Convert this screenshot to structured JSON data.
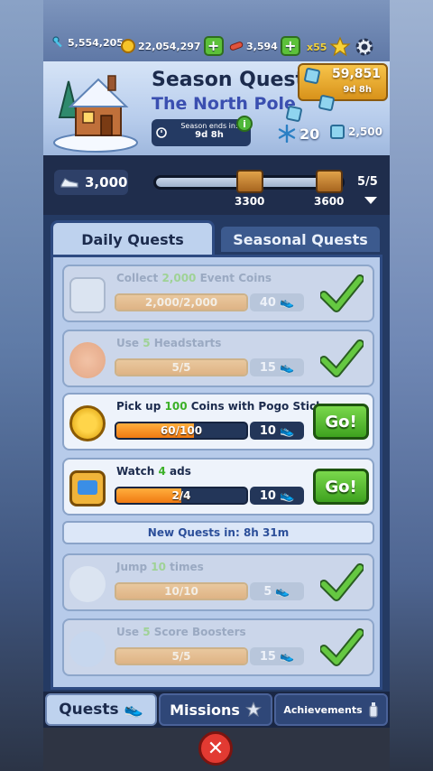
{
  "header": {
    "keys": "5,554,205",
    "coins": "22,054,297",
    "hoverboards": "3,594",
    "multiplier": "x55"
  },
  "season": {
    "title": "Season Quests",
    "subtitle": "The North Pole",
    "ends_label": "Season ends in:",
    "ends_value": "9d 8h",
    "currency_value": "59,851",
    "currency_timer": "9d 8h",
    "ice_count": "20",
    "ice_total": "2,500"
  },
  "progress": {
    "tokens": "3,000",
    "fill_fraction": 1.0,
    "milestones": [
      "3300",
      "3600"
    ],
    "count": "5/5"
  },
  "tabs": {
    "daily": "Daily Quests",
    "seasonal": "Seasonal Quests"
  },
  "quests": [
    {
      "title_pre": "Collect ",
      "title_num": "2,000",
      "title_post": " Event Coins",
      "progress": "2,000/2,000",
      "fraction": 1.0,
      "reward": "40",
      "done": true
    },
    {
      "title_pre": "Use ",
      "title_num": "5",
      "title_post": " Headstarts",
      "progress": "5/5",
      "fraction": 1.0,
      "reward": "15",
      "done": true
    },
    {
      "title_pre": "Pick up ",
      "title_num": "100",
      "title_post": " Coins with Pogo Sticks",
      "progress": "60/100",
      "fraction": 0.6,
      "reward": "10",
      "done": false,
      "action": "Go!"
    },
    {
      "title_pre": "Watch ",
      "title_num": "4",
      "title_post": " ads",
      "progress": "2/4",
      "fraction": 0.5,
      "reward": "10",
      "done": false,
      "action": "Go!"
    },
    {
      "title_pre": "Jump ",
      "title_num": "10",
      "title_post": " times",
      "progress": "10/10",
      "fraction": 1.0,
      "reward": "5",
      "done": true
    },
    {
      "title_pre": "Use ",
      "title_num": "5",
      "title_post": " Score Boosters",
      "progress": "5/5",
      "fraction": 1.0,
      "reward": "15",
      "done": true
    }
  ],
  "new_quests_text": "New Quests in: 8h 31m",
  "bottom_nav": {
    "quests": "Quests",
    "missions": "Missions",
    "achievements": "Achievements"
  },
  "colors": {
    "accent_green": "#3ea21f",
    "progress_orange": "#f07a12",
    "close_red": "#e23a32",
    "panel_blue": "#b7cbea"
  }
}
